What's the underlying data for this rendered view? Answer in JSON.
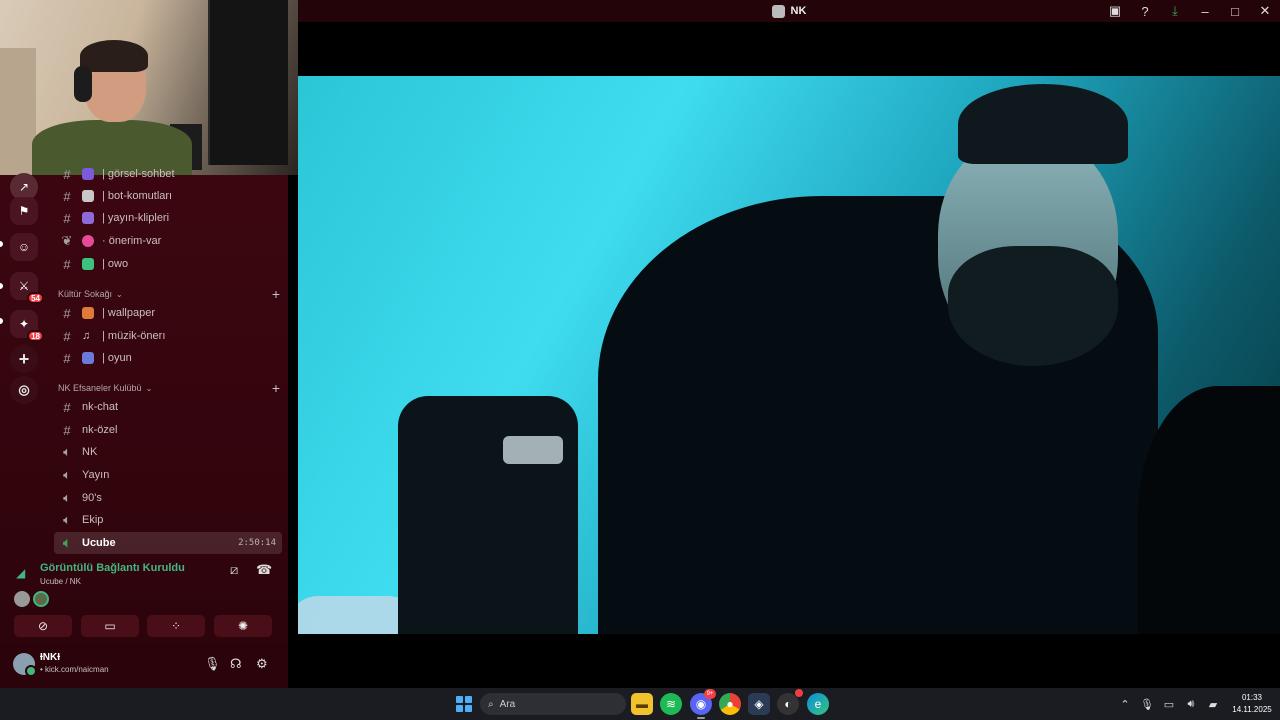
{
  "window": {
    "title": "NK",
    "tools": {
      "inbox_icon": "inbox-icon",
      "help_icon": "help-icon",
      "download_icon": "download-icon",
      "minimize_icon": "minimize-icon",
      "maximize_icon": "maximize-icon",
      "close_icon": "close-icon"
    }
  },
  "server_rail": {
    "badges": [
      "54",
      "18"
    ]
  },
  "channels": [
    {
      "type": "text",
      "emoji_color": "#7a5ad8",
      "name": "| görsel-sohbet"
    },
    {
      "type": "text",
      "emoji_color": "#c8c8c8",
      "name": "| bot-komutları"
    },
    {
      "type": "text",
      "emoji_color": "#8e6ad8",
      "name": "| yayın-klipleri"
    },
    {
      "type": "forum",
      "emoji_color": "#e84a9a",
      "name": "· önerim-var"
    },
    {
      "type": "text",
      "emoji_color": "#3bc47e",
      "name": "| owo"
    }
  ],
  "categories": [
    {
      "name": "Kültür Sokağı",
      "channels": [
        {
          "type": "text",
          "emoji_color": "#e07a3a",
          "name": "| wallpaper"
        },
        {
          "type": "text",
          "emoji_color": "#cfcfcf",
          "name": "| müzik-önerı"
        },
        {
          "type": "text",
          "emoji_color": "#6a7ad8",
          "name": "| oyun"
        }
      ]
    },
    {
      "name": "NK Efsaneler Kulübü",
      "channels": [
        {
          "type": "text",
          "name": "nk-chat"
        },
        {
          "type": "text",
          "name": "nk-özel"
        },
        {
          "type": "voice",
          "name": "NK"
        },
        {
          "type": "voice",
          "name": "Yayın"
        },
        {
          "type": "voice",
          "name": "90's"
        },
        {
          "type": "voice",
          "name": "Ekip"
        },
        {
          "type": "voice",
          "name": "Ucube",
          "active": true,
          "timer": "2:50:14"
        }
      ]
    }
  ],
  "voice": {
    "status": "Görüntülü Bağlantı Kuruldu",
    "location": "Ucube / NK"
  },
  "user": {
    "name": "ƗNKƗ",
    "status": "• kick.com/naicman"
  },
  "taskbar": {
    "search_placeholder": "Ara",
    "discord_badge": "9+",
    "clock_time": "01:33",
    "clock_date": "14.11.2025"
  }
}
